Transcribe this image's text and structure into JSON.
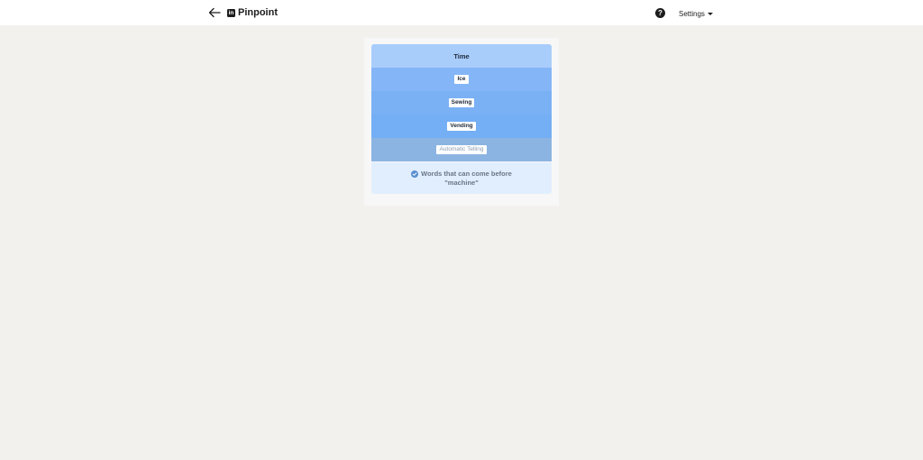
{
  "header": {
    "brand_logo_text": "in",
    "title": "Pinpoint",
    "help_label": "?",
    "settings_label": "Settings"
  },
  "puzzle": {
    "clues": [
      {
        "text": "Time",
        "style": "header"
      },
      {
        "text": "Ice",
        "style": "tag"
      },
      {
        "text": "Sewing",
        "style": "tag"
      },
      {
        "text": "Vending",
        "style": "tag"
      },
      {
        "text": "Automatic Telling",
        "style": "tag-faded"
      }
    ],
    "answer_line1": "Words that can come before",
    "answer_line2": "\"machine\"",
    "answer_status": "correct"
  },
  "colors": {
    "background": "#f3f1ee",
    "header_row": "#a9cdfb",
    "clue_row": "#84b6f7",
    "answer_row": "#e0eefe",
    "check": "#5a8fd0"
  },
  "icons": {
    "back": "arrow-left-icon",
    "logo": "linkedin-logo-icon",
    "help": "question-circle-icon",
    "settings_caret": "caret-down-icon",
    "answer_check": "check-circle-icon"
  }
}
